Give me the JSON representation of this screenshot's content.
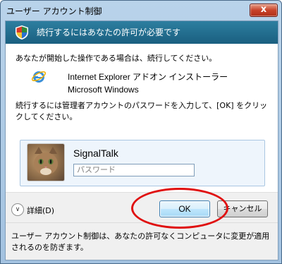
{
  "window": {
    "title": "ユーザー アカウント制御",
    "close_glyph": "x"
  },
  "banner": {
    "text": "続行するにはあなたの許可が必要です",
    "icon": "shield-icon"
  },
  "intro_text": "あなたが開始した操作である場合は、続行してください。",
  "program": {
    "name": "Internet Explorer アドオン インストーラー",
    "publisher": "Microsoft Windows",
    "icon": "internet-explorer-icon"
  },
  "instruction": "続行するには管理者アカウントのパスワードを入力して、[OK] をクリックしてください。",
  "credential": {
    "username": "SignalTalk",
    "password_placeholder": "パスワード",
    "avatar_icon": "cat-avatar"
  },
  "details_label": "詳細(D)",
  "buttons": {
    "ok": "OK",
    "cancel": "キャンセル"
  },
  "footer_text": "ユーザー アカウント制御は、あなたの許可なくコンピュータに変更が適用されるのを防ぎます。",
  "colors": {
    "banner": "#1a5f80",
    "highlight_ring": "#e01010"
  }
}
